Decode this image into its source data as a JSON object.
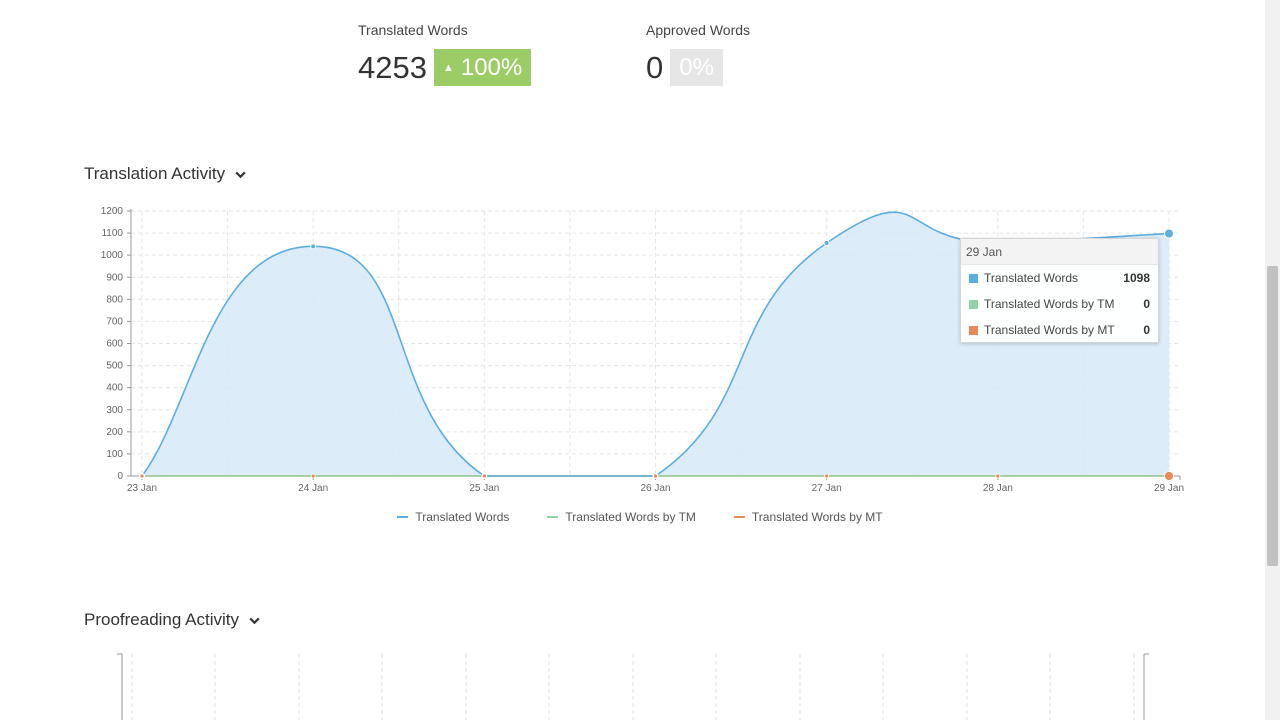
{
  "stats": {
    "translated": {
      "label": "Translated Words",
      "value": "4253",
      "badge": "100%",
      "badge_arrow": "▲"
    },
    "approved": {
      "label": "Approved Words",
      "value": "0",
      "badge": "0%"
    }
  },
  "sections": {
    "translation": {
      "title": "Translation Activity"
    },
    "proofreading": {
      "title": "Proofreading Activity"
    }
  },
  "colors": {
    "translated": "#5aaee0",
    "tm": "#8fd3a6",
    "mt": "#e8895a",
    "badge_green": "#9ccc65"
  },
  "tooltip": {
    "date": "29 Jan",
    "rows": [
      {
        "name": "Translated Words",
        "value": "1098",
        "color": "#5aaee0"
      },
      {
        "name": "Translated Words by TM",
        "value": "0",
        "color": "#8fd3a6"
      },
      {
        "name": "Translated Words by MT",
        "value": "0",
        "color": "#e8895a"
      }
    ]
  },
  "chart_data": {
    "type": "area",
    "x": [
      "23 Jan",
      "24 Jan",
      "25 Jan",
      "26 Jan",
      "27 Jan",
      "28 Jan",
      "29 Jan"
    ],
    "series": [
      {
        "name": "Translated Words",
        "values": [
          0,
          1040,
          0,
          0,
          1055,
          1060,
          1098
        ]
      },
      {
        "name": "Translated Words by TM",
        "values": [
          0,
          0,
          0,
          0,
          0,
          0,
          0
        ]
      },
      {
        "name": "Translated Words by MT",
        "values": [
          0,
          0,
          0,
          0,
          0,
          0,
          0
        ]
      }
    ],
    "yticks": [
      "0",
      "100",
      "200",
      "300",
      "400",
      "500",
      "600",
      "700",
      "800",
      "900",
      "1000",
      "1100",
      "1200"
    ],
    "ylim": [
      0,
      1200
    ],
    "grid": true,
    "legend": "bottom-center"
  }
}
